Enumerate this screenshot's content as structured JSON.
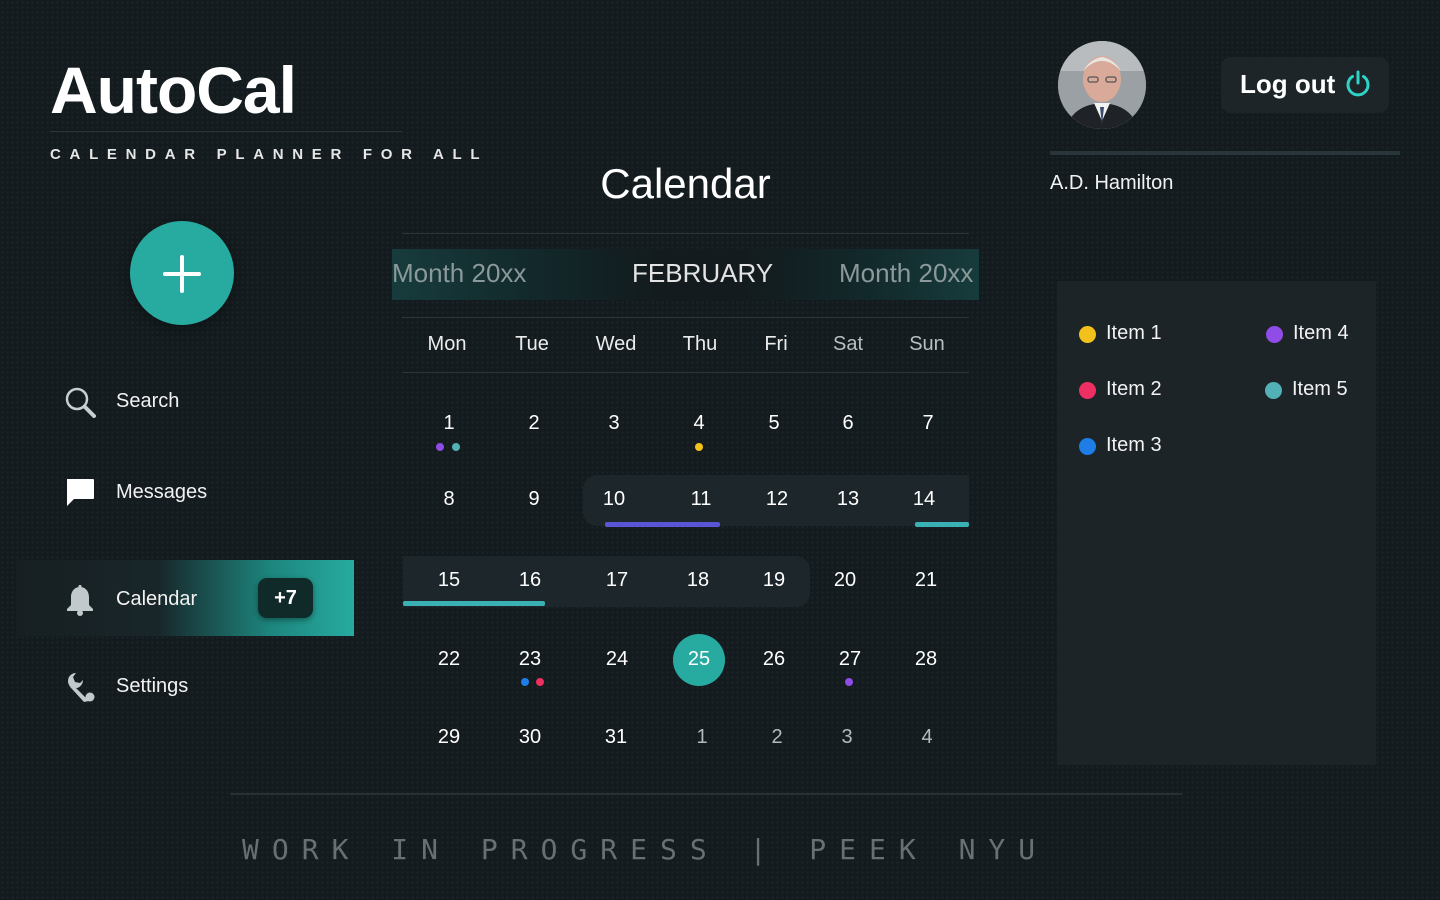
{
  "brand": {
    "title": "AutoCal",
    "tagline": "CALENDAR PLANNER FOR ALL"
  },
  "add_button": {
    "icon": "plus-icon"
  },
  "nav": {
    "items": [
      {
        "id": "search",
        "label": "Search",
        "icon": "search-icon"
      },
      {
        "id": "messages",
        "label": "Messages",
        "icon": "message-icon"
      },
      {
        "id": "calendar",
        "label": "Calendar",
        "icon": "bell-icon",
        "badge": "+7",
        "active": true
      },
      {
        "id": "settings",
        "label": "Settings",
        "icon": "wrench-icon"
      }
    ]
  },
  "calendar": {
    "title": "Calendar",
    "months": {
      "prev": "Month 20xx",
      "current": "FEBRUARY",
      "next": "Month 20xx"
    },
    "weekdays": [
      "Mon",
      "Tue",
      "Wed",
      "Thu",
      "Fri",
      "Sat",
      "Sun"
    ],
    "weeks": [
      [
        "1",
        "2",
        "3",
        "4",
        "5",
        "6",
        "7"
      ],
      [
        "8",
        "9",
        "10",
        "11",
        "12",
        "13",
        "14"
      ],
      [
        "15",
        "16",
        "17",
        "18",
        "19",
        "20",
        "21"
      ],
      [
        "22",
        "23",
        "24",
        "25",
        "26",
        "27",
        "28"
      ],
      [
        "29",
        "30",
        "31",
        "1",
        "2",
        "3",
        "4"
      ]
    ],
    "today": "25"
  },
  "user": {
    "name": "A.D. Hamilton",
    "logout_label": "Log out",
    "logout_icon": "power-icon"
  },
  "legend": {
    "items": [
      {
        "label": "Item 1",
        "color": "#f2c21b"
      },
      {
        "label": "Item 2",
        "color": "#ef2f62"
      },
      {
        "label": "Item 3",
        "color": "#1f7de8"
      },
      {
        "label": "Item 4",
        "color": "#8f4ce6"
      },
      {
        "label": "Item 5",
        "color": "#52b1b6"
      }
    ]
  },
  "colors": {
    "accent": "#27aba0",
    "range_bar_purple": "#5a54d6",
    "range_bar_teal": "#3ab2b3",
    "background": "#131b1e"
  },
  "footer": {
    "text": "WORK IN PROGRESS | PEEK NYU"
  }
}
